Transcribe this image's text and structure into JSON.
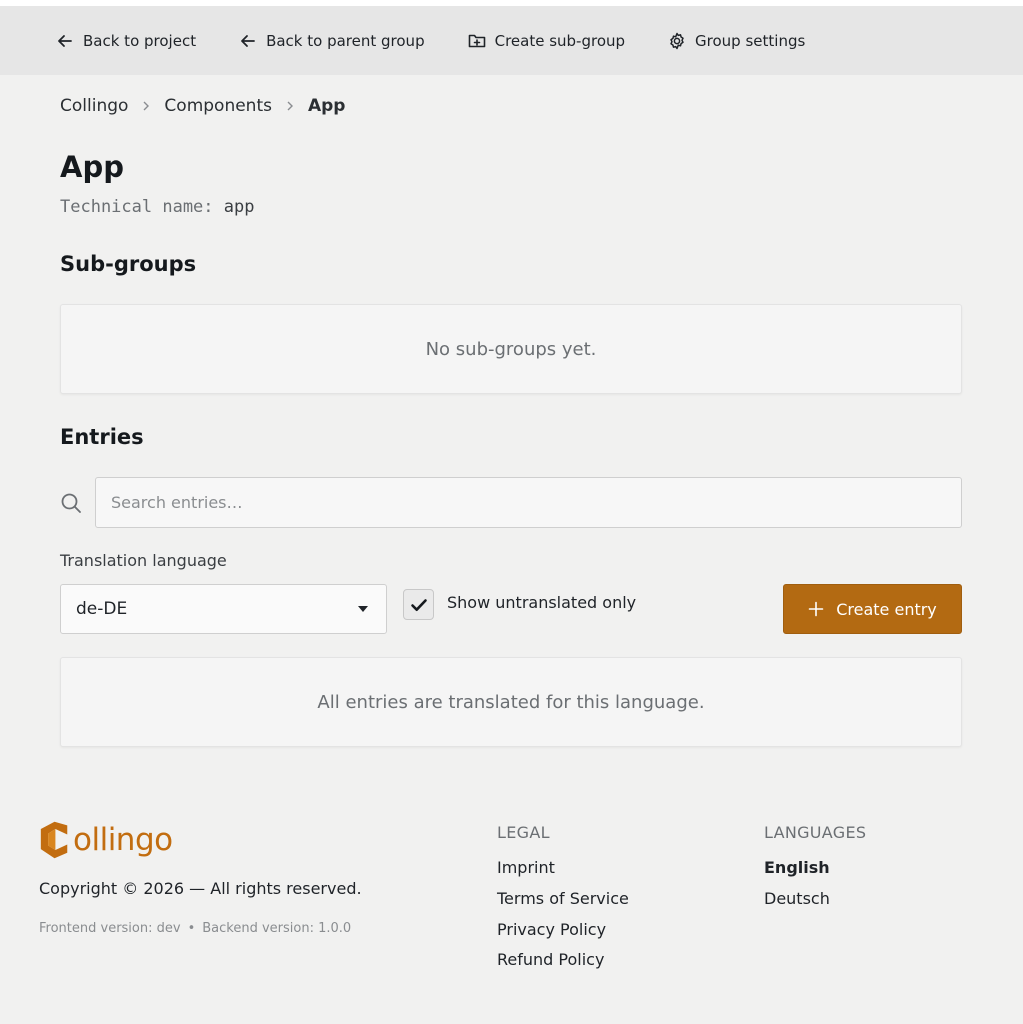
{
  "topbar": {
    "back_to_project": "Back to project",
    "back_to_parent": "Back to parent group",
    "create_subgroup": "Create sub-group",
    "group_settings": "Group settings"
  },
  "breadcrumb": [
    "Collingo",
    "Components",
    "App"
  ],
  "page": {
    "title": "App",
    "technical_label": "Technical name:",
    "technical_value": "app"
  },
  "subgroups": {
    "heading": "Sub-groups",
    "empty": "No sub-groups yet."
  },
  "entries": {
    "heading": "Entries",
    "search_placeholder": "Search entries…",
    "language_label": "Translation language",
    "language_value": "de-DE",
    "show_untranslated_label": "Show untranslated only",
    "show_untranslated_checked": true,
    "create_button": "Create entry",
    "empty": "All entries are translated for this language."
  },
  "footer": {
    "logo_text": "ollingo",
    "copyright": "Copyright © 2026 — All rights reserved.",
    "frontend_version": "Frontend version: dev",
    "bullet": "•",
    "backend_version": "Backend version: 1.0.0",
    "legal_heading": "LEGAL",
    "legal_links": [
      "Imprint",
      "Terms of Service",
      "Privacy Policy",
      "Refund Policy"
    ],
    "languages_heading": "LANGUAGES",
    "languages": [
      "English",
      "Deutsch"
    ],
    "active_language": "English"
  },
  "colors": {
    "accent": "#b36a12",
    "logo": "#c26d10",
    "background": "#f1f1f0",
    "topbar": "#e6e6e6"
  }
}
